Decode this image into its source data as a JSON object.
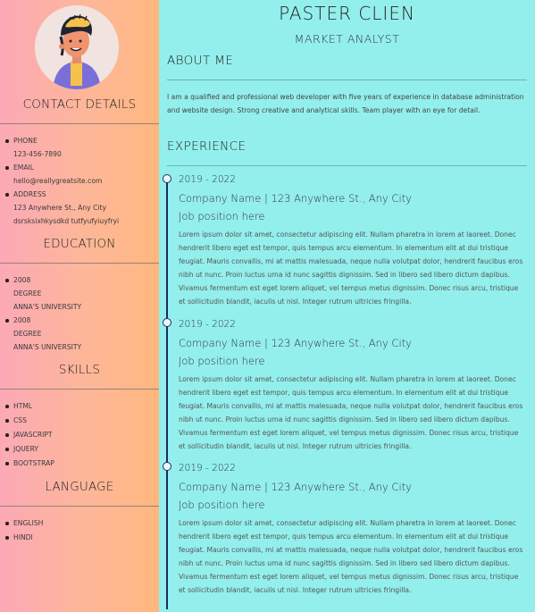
{
  "profile": {
    "name": "PASTER CLIEN",
    "title": "MARKET ANALYST"
  },
  "colors": {
    "sidebar_gradient_start": "#fca9b6",
    "sidebar_gradient_end": "#ffb77f",
    "main_background": "#93efec",
    "timeline": "#1d2c64"
  },
  "contact": {
    "heading": "CONTACT DETAILS",
    "items": [
      {
        "label": "PHONE",
        "value": "123-456-7890"
      },
      {
        "label": "EMAIL",
        "value": "hello@reallygreatsite.com"
      },
      {
        "label": "ADDRESS",
        "value": "123 Anywhere St., Any City",
        "extra": "dsrsksixhkysdkd tutfyufyiuyfryi"
      }
    ]
  },
  "education": {
    "heading": "EDUCATION",
    "items": [
      {
        "year": "2008",
        "degree": "DEGREE",
        "school": "ANNA'S UNIVERSITY"
      },
      {
        "year": "2008",
        "degree": "DEGREE",
        "school": "ANNA'S UNIVERSITY"
      }
    ]
  },
  "skills": {
    "heading": "SKILLS",
    "items": [
      "HTML",
      "CSS",
      "JAVASCRIPT",
      "JQUERY",
      "BOOTSTRAP"
    ]
  },
  "language": {
    "heading": "LANGUAGE",
    "items": [
      "ENGLISH",
      "HINDI"
    ]
  },
  "about": {
    "heading": "ABOUT ME",
    "text": "I am a qualified and professional web developer with five years of experience in database administration and website design. Strong creative and analytical skills. Team player with an eye for detail."
  },
  "experience": {
    "heading": "EXPERIENCE",
    "items": [
      {
        "years": "2019 - 2022",
        "company": "Company Name | 123 Anywhere St., Any City",
        "position": "Job position here",
        "description": "Lorem ipsum dolor sit amet, consectetur adipiscing elit. Nullam pharetra in lorem at laoreet. Donec hendrerit libero eget est tempor, quis tempus arcu elementum. In elementum elit at dui tristique feugiat. Mauris convallis, mi at mattis malesuada, neque nulla volutpat dolor, hendrerit faucibus eros nibh ut nunc. Proin luctus urna id nunc sagittis dignissim. Sed in libero sed libero dictum dapibus. Vivamus fermentum est eget lorem aliquet, vel tempus metus dignissim. Donec risus arcu, tristique et sollicitudin blandit, iaculis ut nisl. Integer rutrum ultricies fringilla."
      },
      {
        "years": "2019 - 2022",
        "company": "Company Name | 123 Anywhere St., Any City",
        "position": "Job position here",
        "description": "Lorem ipsum dolor sit amet, consectetur adipiscing elit. Nullam pharetra in lorem at laoreet. Donec hendrerit libero eget est tempor, quis tempus arcu elementum. In elementum elit at dui tristique feugiat. Mauris convallis, mi at mattis malesuada, neque nulla volutpat dolor, hendrerit faucibus eros nibh ut nunc. Proin luctus urna id nunc sagittis dignissim. Sed in libero sed libero dictum dapibus. Vivamus fermentum est eget lorem aliquet, vel tempus metus dignissim. Donec risus arcu, tristique et sollicitudin blandit, iaculis ut nisl. Integer rutrum ultricies fringilla."
      },
      {
        "years": "2019 - 2022",
        "company": "Company Name | 123 Anywhere St., Any City",
        "position": "Job position here",
        "description": "Lorem ipsum dolor sit amet, consectetur adipiscing elit. Nullam pharetra in lorem at laoreet. Donec hendrerit libero eget est tempor, quis tempus arcu elementum. In elementum elit at dui tristique feugiat. Mauris convallis, mi at mattis malesuada, neque nulla volutpat dolor, hendrerit faucibus eros nibh ut nunc. Proin luctus urna id nunc sagittis dignissim. Sed in libero sed libero dictum dapibus. Vivamus fermentum est eget lorem aliquet, vel tempus metus dignissim. Donec risus arcu, tristique et sollicitudin blandit, iaculis ut nisl. Integer rutrum ultricies fringilla."
      }
    ]
  }
}
